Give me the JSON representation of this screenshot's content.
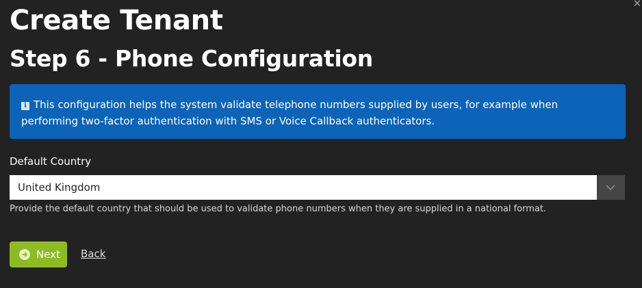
{
  "dialog": {
    "close_icon": "close-icon",
    "title": "Create Tenant",
    "subtitle": "Step 6 - Phone Configuration"
  },
  "info": {
    "icon": "info-icon",
    "text": "This configuration helps the system validate telephone numbers supplied by users, for example when performing two-factor authentication with SMS or Voice Callback authenticators."
  },
  "form": {
    "default_country": {
      "label": "Default Country",
      "value": "United Kingdom",
      "help": "Provide the default country that should be used to validate phone numbers when they are supplied in a national format."
    }
  },
  "actions": {
    "next_label": "Next",
    "back_label": "Back"
  },
  "colors": {
    "background": "#222222",
    "info_box": "#0d63b7",
    "next_button": "#8dbb22"
  }
}
